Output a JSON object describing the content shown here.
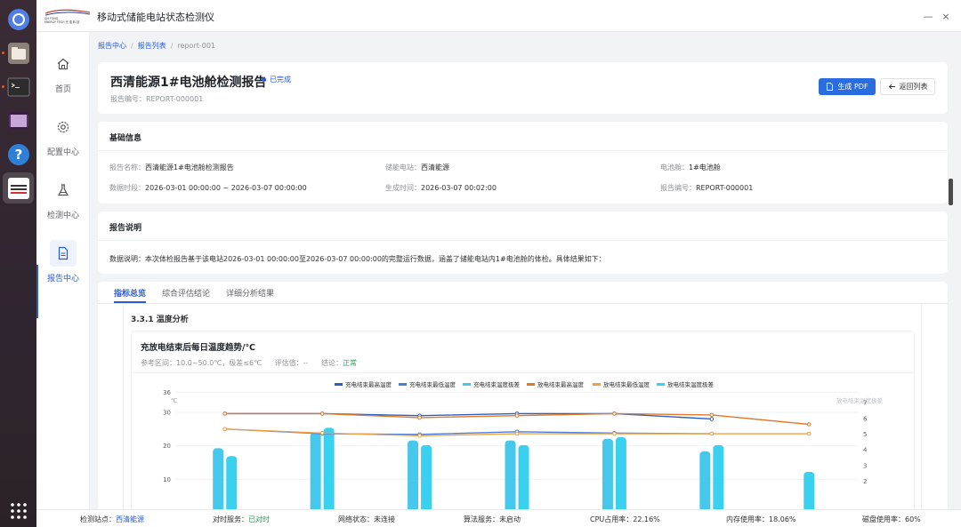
{
  "app": {
    "title": "移动式储能电站状态检测仪",
    "logo_text": "GH TONG ENERGY TECH 光 浩 科 技",
    "minimize": "—",
    "close": "×"
  },
  "nav": {
    "items": [
      {
        "label": "首页",
        "icon": "home-icon"
      },
      {
        "label": "配置中心",
        "icon": "gear-icon"
      },
      {
        "label": "检测中心",
        "icon": "flask-icon"
      },
      {
        "label": "报告中心",
        "icon": "document-icon"
      }
    ],
    "active": "报告中心"
  },
  "breadcrumb": {
    "items": [
      "报告中心",
      "报告列表",
      "report-001"
    ],
    "sep": "/"
  },
  "header": {
    "title": "西清能源1#电池舱检测报告",
    "status": "已完成",
    "code": "报告编号：REPORT-000001",
    "pdf_button": "生成 PDF",
    "back_button": "返回列表"
  },
  "basic_info": {
    "title": "基础信息",
    "fields": [
      {
        "label": "报告名称：",
        "value": "西清能源1#电池舱检测报告"
      },
      {
        "label": "储能电站：",
        "value": "西清能源"
      },
      {
        "label": "电池舱：",
        "value": "1#电池舱"
      },
      {
        "label": "数据时段：",
        "value": "2026-03-01 00:00:00 ~ 2026-03-07 00:00:00"
      },
      {
        "label": "生成时间：",
        "value": "2026-03-07 00:02:00"
      },
      {
        "label": "报告编号：",
        "value": "REPORT-000001"
      }
    ]
  },
  "description": {
    "title": "报告说明",
    "text": "数据说明：本次体检报告基于该电站2026-03-01 00:00:00至2026-03-07 00:00:00的完整运行数据，涵盖了储能电站内1#电池舱的体检。具体结果如下："
  },
  "tabs": {
    "items": [
      "指标总览",
      "综合评估结论",
      "详细分析结果"
    ],
    "active": "指标总览"
  },
  "section": {
    "title": "3.3.1 温度分析"
  },
  "chart_card": {
    "title": "充放电结束后每日温度趋势/℃",
    "ref_label": "参考区间：",
    "ref_value": "10.0~50.0℃，极差≤6℃",
    "eval_label": "评估值：",
    "eval_value": "--",
    "conclusion_label": "结论：",
    "conclusion_value": "正常"
  },
  "chart_data": {
    "type": "line",
    "left_axis": {
      "unit": "℃",
      "ticks": [
        10,
        20,
        30,
        36
      ],
      "range": [
        0,
        36
      ]
    },
    "right_axis": {
      "name": "放电结束温度极差",
      "ticks": [
        2,
        3,
        4,
        5,
        6,
        7
      ],
      "range": [
        0,
        7
      ]
    },
    "days": 7,
    "series": [
      {
        "name": "充电结束最高温度",
        "kind": "line",
        "axis": "left",
        "color": "#2f5fc4",
        "values": [
          29.6,
          29.6,
          29.0,
          29.6,
          29.6,
          28.0
        ]
      },
      {
        "name": "充电结束最低温度",
        "kind": "line",
        "axis": "left",
        "color": "#4a7fd8",
        "values": [
          25.0,
          23.6,
          23.4,
          24.2,
          23.8,
          23.6
        ]
      },
      {
        "name": "充电结束温度极差",
        "kind": "bar",
        "axis": "right",
        "color": "#46c8ec",
        "values": [
          4.1,
          5.1,
          4.6,
          4.6,
          4.7,
          3.9
        ]
      },
      {
        "name": "放电结束最高温度",
        "kind": "line",
        "axis": "left",
        "color": "#e07a28",
        "values": [
          29.6,
          29.6,
          28.4,
          29.0,
          29.6,
          29.2,
          26.4
        ]
      },
      {
        "name": "放电结束最低温度",
        "kind": "line",
        "axis": "left",
        "color": "#f0a142",
        "values": [
          25.0,
          23.8,
          23.0,
          23.6,
          23.6,
          23.6,
          23.6
        ]
      },
      {
        "name": "放电结束温度极差",
        "kind": "bar",
        "axis": "right",
        "color": "#3ad0f0",
        "values": [
          3.6,
          5.4,
          4.3,
          4.3,
          4.8,
          4.3,
          2.6
        ]
      }
    ]
  },
  "statusbar": {
    "station_label": "检测站点：",
    "station_value": "西清能源",
    "time_label": "对时服务：",
    "time_value": "已对时",
    "net_label": "网络状态：",
    "net_value": "未连接",
    "algo_label": "算法服务：",
    "algo_value": "未启动",
    "cpu_label": "CPU占用率：",
    "cpu_value": "22.16%",
    "mem_label": "内存使用率：",
    "mem_value": "18.06%",
    "disk_label": "磁盘使用率：",
    "disk_value": "60%"
  }
}
